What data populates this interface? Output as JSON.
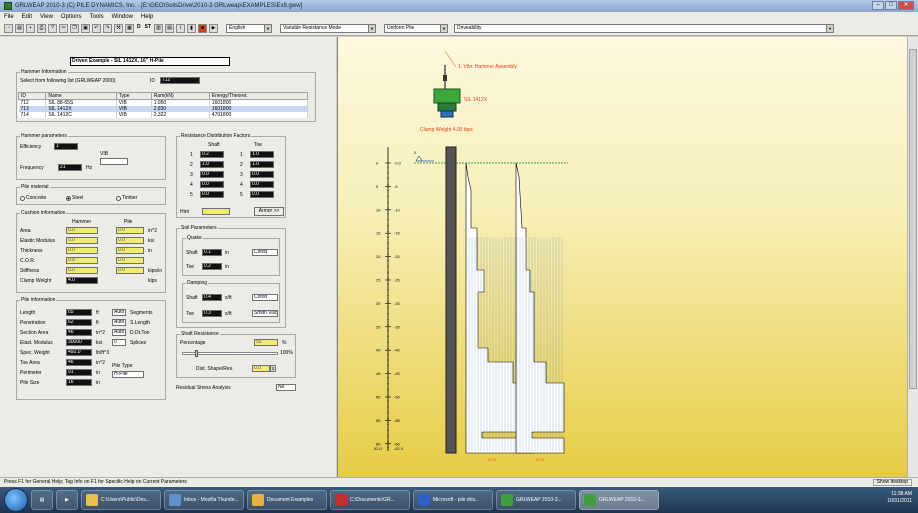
{
  "window": {
    "title": "GRLWEAP 2010-3 (C) PILE DYNAMICS, Inc.  ·  [E:\\GEO\\SoilsDrive\\2010-3 GRLweap\\EXAMPLES\\Ex8.gww]"
  },
  "menu": [
    "File",
    "Edit",
    "View",
    "Options",
    "Tools",
    "Window",
    "Help"
  ],
  "toolbar": {
    "st_label": "ST",
    "d_label": "D",
    "units": "English",
    "resistance": "Variable Resistance Mode",
    "pile_file": "Uniform Pile",
    "driveability": "Driveability"
  },
  "left": {
    "title": "Driven Example - SIL 1412X, 16\" H-Pile",
    "hammer_info": {
      "label": "Hammer Information",
      "select_text": "Select from following list (GRLWEAP 2000)",
      "id_label": "ID",
      "id_value": "712",
      "columns": [
        "ID",
        "Name",
        "Type",
        "Ram(kN)",
        "Energy/Theoret."
      ],
      "rows": [
        [
          "712",
          "SIL 88-65S",
          "VIB",
          "1.950",
          "1601800"
        ],
        [
          "713",
          "SIL 1412X",
          "VIB",
          "2.830",
          "1601800"
        ],
        [
          "714",
          "SIL 1412C",
          "VIB",
          "2.322",
          "4701800"
        ]
      ]
    },
    "hammer_params": {
      "label": "Hammer parameters",
      "efficiency_label": "Efficiency",
      "efficiency_value": "1",
      "frequency_label": "Frequency",
      "frequency_value": "21",
      "frequency_unit": "Hz",
      "vib_label": "VIB"
    },
    "pile_material": {
      "label": "Pile material",
      "options": [
        "Concrete",
        "Steel",
        "Timber"
      ],
      "selected": 1
    },
    "cushion": {
      "label": "Cushion information",
      "col1": "Hammer",
      "col2": "Pile",
      "rows": [
        {
          "label": "Area",
          "h": "0.0",
          "p": "0.0",
          "unit": "in^2"
        },
        {
          "label": "Elastic Modulus",
          "h": "0.0",
          "p": "0.0",
          "unit": "ksi"
        },
        {
          "label": "Thickness",
          "h": "0.0",
          "p": "0.0",
          "unit": "in"
        },
        {
          "label": "C.O.R.",
          "h": "0.8",
          "p": "0.0",
          "unit": ""
        },
        {
          "label": "Stiffness",
          "h": "0.0",
          "p": "0.0",
          "unit": "kips/in"
        },
        {
          "label": "Clamp Weight",
          "h": "4.0",
          "p": "",
          "unit": "kips"
        }
      ]
    },
    "pile_info": {
      "label": "Pile information",
      "rows": [
        {
          "label": "Length",
          "value": "65",
          "unit": "ft",
          "extra": "Auto",
          "extra2": "Segments"
        },
        {
          "label": "Penetration",
          "value": "62",
          "unit": "ft",
          "extra": "Auto",
          "extra2": "S.Length"
        },
        {
          "label": "Section Area",
          "value": "46",
          "unit": "in^2",
          "extra": "Auto",
          "extra2": "D.Dt.Toe"
        },
        {
          "label": "Elast. Modulus",
          "value": "30000",
          "unit": "ksi",
          "extra": "0",
          "extra2": "Splices"
        },
        {
          "label": "Spec. Weight",
          "value": "492.0",
          "unit": "lb/ft^3",
          "extra": "",
          "extra2": ""
        },
        {
          "label": "Toe Area",
          "value": "46",
          "unit": "in^2",
          "extra": "",
          "extra2": ""
        },
        {
          "label": "Perimeter",
          "value": "91",
          "unit": "in",
          "extra": "",
          "extra2": ""
        },
        {
          "label": "Pile Size",
          "value": "16",
          "unit": "in",
          "extra": "",
          "extra2": ""
        }
      ],
      "pile_type_label": "Pile Type",
      "pile_type_value": "H-Pile"
    },
    "dist": {
      "label": "Resistance Distribution Factors",
      "shaft_label": "Shaft",
      "toe_label": "Toe",
      "rows": [
        {
          "n": "1",
          "s": "0.2",
          "t": "1.0"
        },
        {
          "n": "2",
          "s": "1.0",
          "t": "1.0"
        },
        {
          "n": "3",
          "s": "0.0",
          "t": "0.0"
        },
        {
          "n": "4",
          "s": "0.0",
          "t": "0.0"
        },
        {
          "n": "5",
          "s": "0.0",
          "t": "0.0"
        }
      ],
      "hint_label": "Hint",
      "button": "Armor >>"
    },
    "soil": {
      "label": "Soil Parameters",
      "quake_label": "Quake",
      "quake_shaft_label": "Shaft",
      "quake_shaft": "0.1",
      "quake_shaft_unit": "in",
      "quake_toe_label": "Toe",
      "quake_toe": "0.2",
      "quake_toe_unit": "in",
      "const_label": "Const",
      "damping_label": "Damping",
      "damp_shaft_label": "Shaft",
      "damp_shaft": "0.4",
      "damp_shaft_unit": "s/ft",
      "damp_toe_label": "Toe",
      "damp_toe": "0.3",
      "damp_toe_unit": "s/ft",
      "smith_label": "Smith Visc."
    },
    "shaft_res": {
      "label": "Shaft Resistance",
      "percentage_label": "Percentage",
      "percentage_value": "50",
      "percent_unit": "%",
      "slider_max": "100%",
      "dist_label": "Dist. Shape/Res.",
      "dist_value": "0.0"
    },
    "residual": {
      "label": "Residual Stress Analysis",
      "value": "No"
    }
  },
  "right": {
    "top_annot": "1: Vibr. Hammer Assembly",
    "mid_annot": "SIL 1412X",
    "clamp_annot": "Clamp Weight 4.00 kips",
    "ground_label": "0",
    "depth_ticks": [
      "0",
      "5",
      "10",
      "15",
      "20",
      "25",
      "30",
      "35",
      "40",
      "45",
      "50",
      "55",
      "60"
    ],
    "right_ticks": [
      "-0.0",
      "-5",
      "-10",
      "-15",
      "-20",
      "-25",
      "-30",
      "-35",
      "-40",
      "-45",
      "-50",
      "-55",
      "-60"
    ],
    "bottom_depth": "62.0",
    "bottom_right": "-62.0",
    "bottom_a": "27.0",
    "bottom_b": "27.0"
  },
  "status": {
    "text": "Press F1 for General Help; Tag Info on F1 for Specific Help on Current Parameters",
    "right": "Show desktop"
  },
  "taskbar": {
    "apps": [
      {
        "label": "C:\\Users\\Public\\Des...",
        "color": "#e8c050"
      },
      {
        "label": "Inbox - Mozilla Thunde...",
        "color": "#6090d0"
      },
      {
        "label": "Document Examples",
        "color": "#e8b040"
      },
      {
        "label": "C:\\Documents\\GR...",
        "color": "#c03030"
      },
      {
        "label": "Microsoft - pile driv...",
        "color": "#3060c0"
      },
      {
        "label": "GRLWEAP 2010-3...",
        "color": "#40a040"
      },
      {
        "label": "GRLWEAP 2010-3...",
        "color": "#40a040"
      }
    ],
    "time": "11:38 AM",
    "date": "10/31/2011"
  }
}
